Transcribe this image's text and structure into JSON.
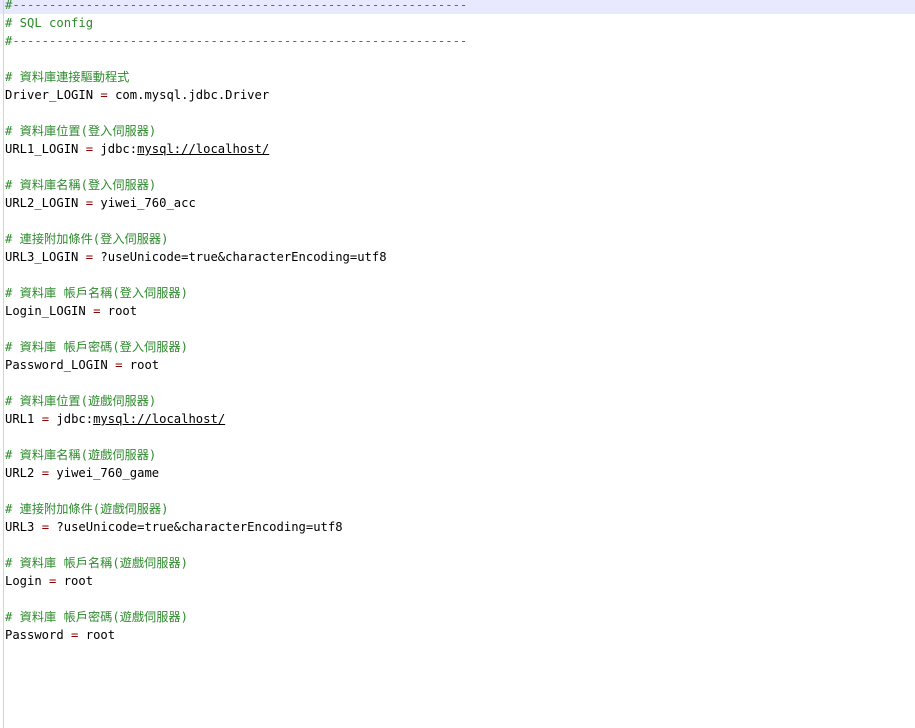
{
  "colors": {
    "comment": "#2e8b2e",
    "key_text": "#000000",
    "operator": "#8b0000",
    "current_line_highlight": "#e8e8ff",
    "background": "#ffffff"
  },
  "header": {
    "rule_top": "#--------------------------------------------------------------",
    "title": "# SQL config",
    "rule_bottom": "#--------------------------------------------------------------"
  },
  "entries": [
    {
      "comment": "# 資料庫連接驅動程式",
      "key": "Driver_LOGIN",
      "op": "=",
      "value": "com.mysql.jdbc.Driver"
    },
    {
      "comment": "# 資料庫位置(登入伺服器)",
      "key": "URL1_LOGIN",
      "op": "=",
      "value_prefix": "jdbc:",
      "value_link": "mysql://localhost/"
    },
    {
      "comment": "# 資料庫名稱(登入伺服器)",
      "key": "URL2_LOGIN",
      "op": "=",
      "value": "yiwei_760_acc"
    },
    {
      "comment": "# 連接附加條件(登入伺服器)",
      "key": "URL3_LOGIN",
      "op": "=",
      "value": "?useUnicode=true&characterEncoding=utf8"
    },
    {
      "comment": "# 資料庫 帳戶名稱(登入伺服器)",
      "key": "Login_LOGIN",
      "op": "=",
      "value": "root"
    },
    {
      "comment": "# 資料庫 帳戶密碼(登入伺服器)",
      "key": "Password_LOGIN",
      "op": "=",
      "value": "root"
    },
    {
      "comment": "# 資料庫位置(遊戲伺服器)",
      "key": "URL1",
      "op": "=",
      "value_prefix": "jdbc:",
      "value_link": "mysql://localhost/"
    },
    {
      "comment": "# 資料庫名稱(遊戲伺服器)",
      "key": "URL2",
      "op": "=",
      "value": "yiwei_760_game"
    },
    {
      "comment": "# 連接附加條件(遊戲伺服器)",
      "key": "URL3",
      "op": "=",
      "value": "?useUnicode=true&characterEncoding=utf8"
    },
    {
      "comment": "# 資料庫 帳戶名稱(遊戲伺服器)",
      "key": "Login",
      "op": "=",
      "value": "root"
    },
    {
      "comment": "# 資料庫 帳戶密碼(遊戲伺服器)",
      "key": "Password",
      "op": "=",
      "value": "root"
    }
  ]
}
